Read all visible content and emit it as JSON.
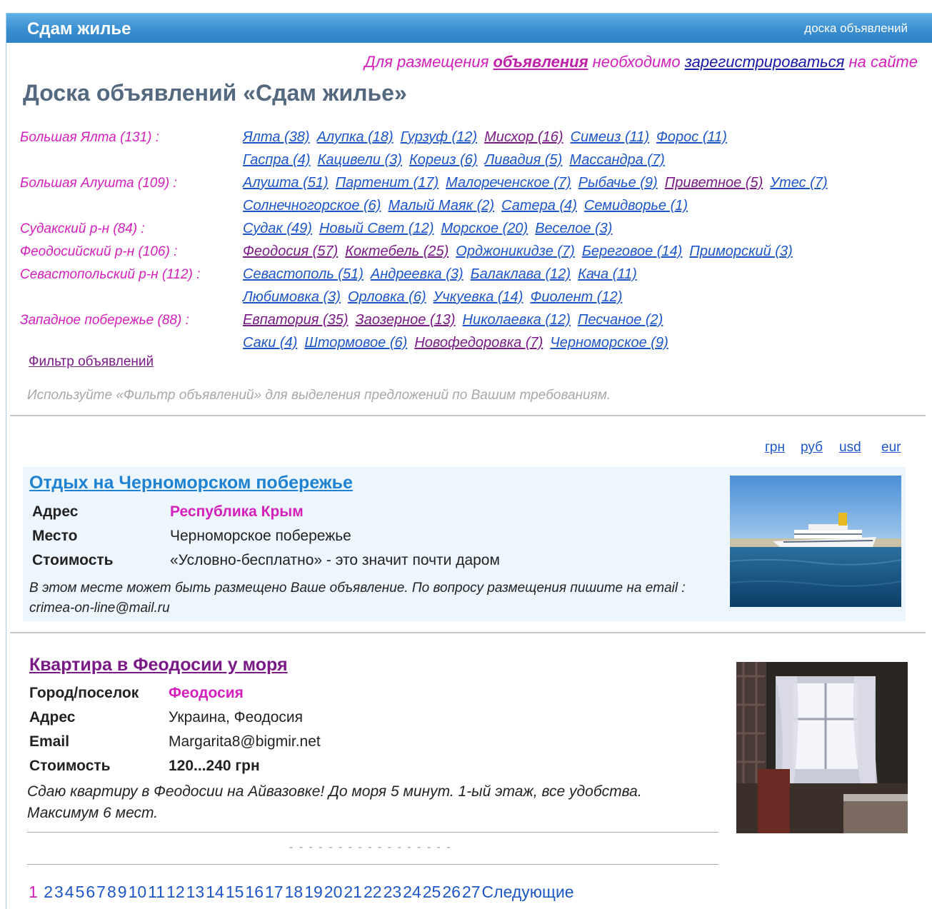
{
  "header": {
    "title": "Сдам жилье",
    "right_link": "доска объявлений"
  },
  "notice": {
    "part1": "Для размещения ",
    "link1": "объявления",
    "part2": " необходимо ",
    "link2": "зарегистрироваться",
    "part3": " на сайте"
  },
  "board_title": "Доска объявлений «Сдам жилье»",
  "regions": [
    {
      "label": "Большая Ялта (131) :",
      "lines": [
        [
          {
            "t": "Ялта (38)"
          },
          {
            "t": "Алупка (18)"
          },
          {
            "t": "Гурзуф (12)"
          },
          {
            "t": "Мисхор (16)",
            "v": true
          },
          {
            "t": "Симеиз (11)"
          },
          {
            "t": "Форос (11)"
          }
        ],
        [
          {
            "t": "Гаспра (4)"
          },
          {
            "t": "Кацивели (3)"
          },
          {
            "t": "Кореиз (6)"
          },
          {
            "t": "Ливадия (5)"
          },
          {
            "t": "Массандра (7)"
          }
        ]
      ]
    },
    {
      "label": "Большая Алушта (109) :",
      "lines": [
        [
          {
            "t": "Алушта (51)"
          },
          {
            "t": "Партенит (17)"
          },
          {
            "t": "Малореченское (7)"
          },
          {
            "t": "Рыбачье (9)"
          },
          {
            "t": "Приветное (5)",
            "v": true
          },
          {
            "t": "Утес (7)"
          }
        ],
        [
          {
            "t": "Солнечногорское (6)"
          },
          {
            "t": "Малый Маяк (2)"
          },
          {
            "t": "Сатера (4)"
          },
          {
            "t": "Семидворье (1)"
          }
        ]
      ]
    },
    {
      "label": "Судакский р-н (84) :",
      "lines": [
        [
          {
            "t": "Судак (49)"
          },
          {
            "t": "Новый Свет (12)"
          },
          {
            "t": "Морское (20)"
          },
          {
            "t": "Веселое (3)"
          }
        ]
      ]
    },
    {
      "label": "Феодосийский р-н (106) :",
      "lines": [
        [
          {
            "t": "Феодосия (57)",
            "v": true
          },
          {
            "t": "Коктебель (25)",
            "v": true
          },
          {
            "t": "Орджоникидзе (7)"
          },
          {
            "t": "Береговое (14)"
          },
          {
            "t": "Приморский (3)"
          }
        ]
      ]
    },
    {
      "label": "Севастопольский р-н (112) :",
      "lines": [
        [
          {
            "t": "Севастополь (51)"
          },
          {
            "t": "Андреевка (3)"
          },
          {
            "t": "Балаклава (12)"
          },
          {
            "t": "Кача (11)"
          }
        ],
        [
          {
            "t": "Любимовка (3)"
          },
          {
            "t": "Орловка (6)"
          },
          {
            "t": "Учкуевка (14)"
          },
          {
            "t": "Фиолент (12)"
          }
        ]
      ]
    },
    {
      "label": "Западное побережье (88) :",
      "lines": [
        [
          {
            "t": "Евпатория (35)",
            "v": true
          },
          {
            "t": "Заозерное (13)",
            "v": true
          },
          {
            "t": "Николаевка (12)"
          },
          {
            "t": "Песчаное (2)"
          }
        ],
        [
          {
            "t": "Саки (4)"
          },
          {
            "t": "Штормовое (6)"
          },
          {
            "t": "Новофедоровка (7)",
            "v": true
          },
          {
            "t": "Черноморское (9)"
          }
        ]
      ]
    }
  ],
  "filter_link": "Фильтр объявлений",
  "hint": "Используйте «Фильтр объявлений» для выделения предложений по Вашим требованиям.",
  "currency": [
    "грн",
    "руб",
    "usd",
    "eur"
  ],
  "ad1": {
    "title": "Отдых на Черноморском побережье",
    "address_label": "Адрес",
    "address": "Республика Крым",
    "place_label": "Место",
    "place": "Черноморское побережье",
    "price_label": "Стоимость",
    "price": "«Условно-бесплатно» - это значит почти даром",
    "desc": "В этом месте может быть размещено Ваше объявление. По вопросу размещения пишите на email : crimea-on-line@mail.ru"
  },
  "ad2": {
    "title": "Квартира в Феодосии у моря",
    "city_label": "Город/поселок",
    "city": "Феодосия",
    "address_label": "Адрес",
    "address": "Украина, Феодосия",
    "email_label": "Email",
    "email": "Margarita8@bigmir.net",
    "price_label": "Стоимость",
    "price": "120...240 грн",
    "desc": "Сдаю квартиру в Феодосии на Айвазовке! До моря 5 минут. 1-ый этаж, все удобства. Максимум 6 мест."
  },
  "dots": "- - - - - - - - - - - - - - - - -",
  "pager": {
    "current": "1",
    "pages": [
      "2",
      "3",
      "4",
      "5",
      "6",
      "7",
      "8",
      "9",
      "10",
      "11",
      "12",
      "13",
      "14",
      "15",
      "16",
      "17",
      "18",
      "19",
      "20",
      "21",
      "22",
      "23",
      "24",
      "25",
      "26",
      "27"
    ],
    "next": "Следующие"
  },
  "colors": {
    "header": "#3a8fd0",
    "accent_pink": "#d41fbd",
    "link": "#1d56c8",
    "visited": "#7a1a86"
  }
}
